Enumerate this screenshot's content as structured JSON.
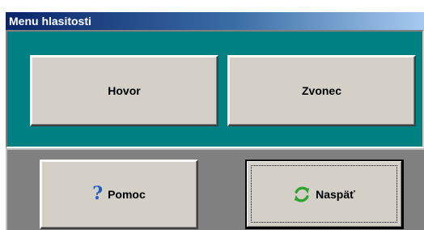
{
  "window": {
    "title": "Menu hlasitosti"
  },
  "buttons": {
    "hovor": "Hovor",
    "zvonec": "Zvonec",
    "pomoc": "Pomoc",
    "naspat": "Naspäť"
  },
  "icons": {
    "help": "question-mark",
    "back": "refresh-arrows"
  },
  "colors": {
    "title_start": "#0a246a",
    "title_end": "#a6caf0",
    "top_panel": "#008080",
    "bottom_panel": "#808080",
    "button_face": "#d4d0c8",
    "help_icon": "#1f5fc0",
    "refresh_icon": "#2ea32e"
  }
}
